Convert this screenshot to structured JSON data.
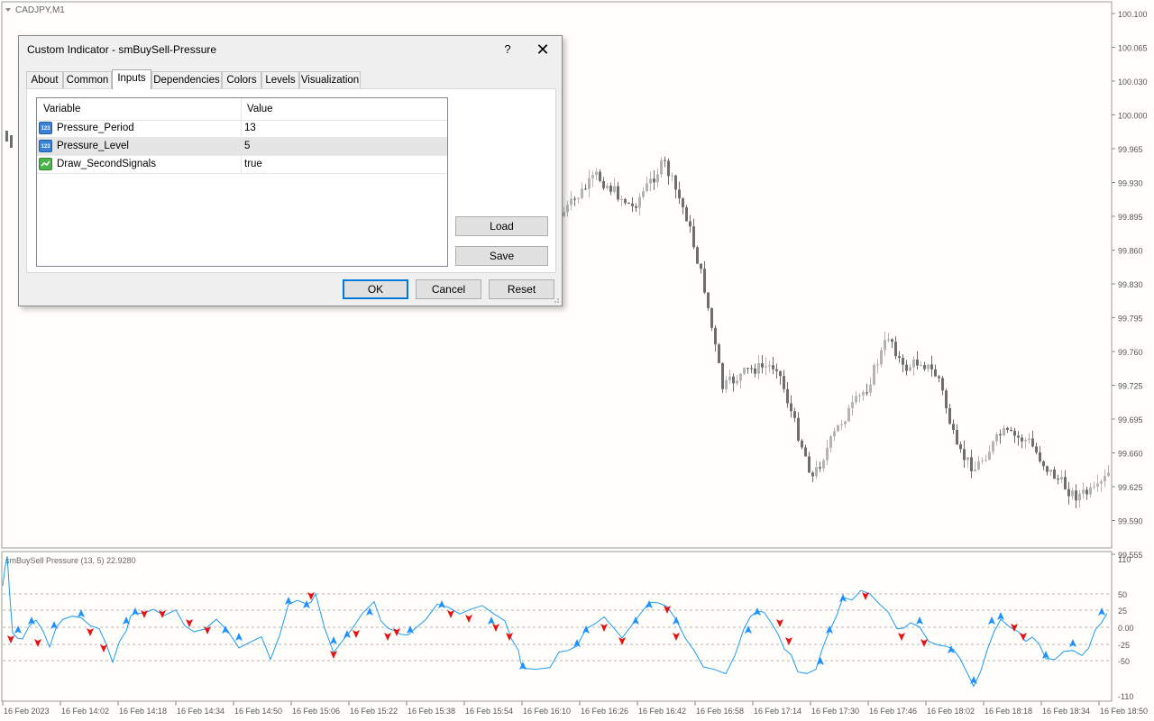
{
  "chart": {
    "symbol_label": "CADJPY,M1",
    "price_labels": [
      "100.100",
      "100.065",
      "100.030",
      "100.000",
      "99.965",
      "99.930",
      "99.895",
      "99.860",
      "99.830",
      "99.795",
      "99.760",
      "99.725",
      "99.695",
      "99.660",
      "99.625",
      "99.590",
      "99.555"
    ],
    "indicator_label": "smBuySell Pressure (13, 5) 22.9280",
    "indicator_levels": [
      "110",
      "50",
      "25",
      "0.00",
      "-25",
      "-50",
      "-110"
    ],
    "time_labels": [
      "16 Feb 2023",
      "16 Feb 14:02",
      "16 Feb 14:18",
      "16 Feb 14:34",
      "16 Feb 14:50",
      "16 Feb 15:06",
      "16 Feb 15:22",
      "16 Feb 15:38",
      "16 Feb 15:54",
      "16 Feb 16:10",
      "16 Feb 16:26",
      "16 Feb 16:42",
      "16 Feb 16:58",
      "16 Feb 17:14",
      "16 Feb 17:30",
      "16 Feb 17:46",
      "16 Feb 18:02",
      "16 Feb 18:18",
      "16 Feb 18:34",
      "16 Feb 18:50"
    ],
    "colors": {
      "bull_candle": "#b4b4b4",
      "bear_candle": "#6e6e6e",
      "indicator_line": "#1e9bf0",
      "buy_arrow": "#1e90ff",
      "sell_arrow": "#e81010",
      "level_line": "#a0a0a0"
    }
  },
  "dialog": {
    "title": "Custom Indicator - smBuySell-Pressure",
    "help_label": "?",
    "close_label": "✕",
    "tabs": [
      "About",
      "Common",
      "Inputs",
      "Dependencies",
      "Colors",
      "Levels",
      "Visualization"
    ],
    "active_tab": "Inputs",
    "grid": {
      "col_variable": "Variable",
      "col_value": "Value",
      "rows": [
        {
          "name": "Pressure_Period",
          "value": "13",
          "icon": "number-icon"
        },
        {
          "name": "Pressure_Level",
          "value": "5",
          "icon": "number-icon"
        },
        {
          "name": "Draw_SecondSignals",
          "value": "true",
          "icon": "bool-icon"
        }
      ]
    },
    "buttons": {
      "load": "Load",
      "save": "Save",
      "ok": "OK",
      "cancel": "Cancel",
      "reset": "Reset"
    }
  }
}
